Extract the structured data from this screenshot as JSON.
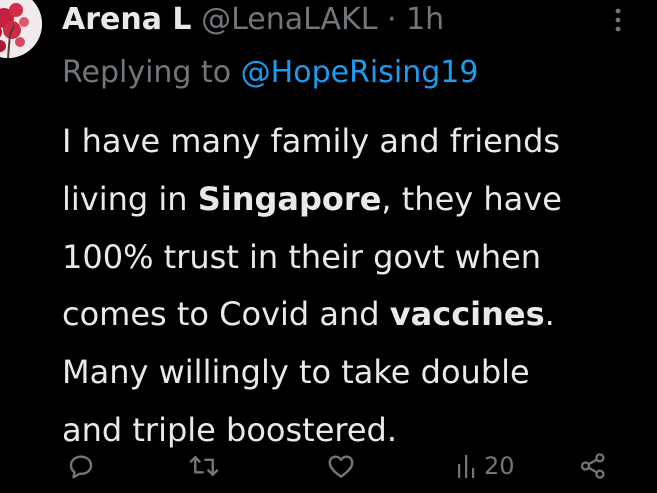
{
  "tweet": {
    "display_name": "Arena L",
    "handle": "@LenaLAKL",
    "separator": "·",
    "time": "1h",
    "replying_prefix": "Replying to ",
    "replying_to": "@HopeRising19",
    "lines": [
      [
        {
          "text": "I have many family and friends",
          "bold": false
        }
      ],
      [
        {
          "text": "living in ",
          "bold": false
        },
        {
          "text": "Singapore",
          "bold": true
        },
        {
          "text": ", they have",
          "bold": false
        }
      ],
      [
        {
          "text": "100% trust in their govt when",
          "bold": false
        }
      ],
      [
        {
          "text": "comes to Covid and ",
          "bold": false
        },
        {
          "text": "vaccines",
          "bold": true
        },
        {
          "text": ".",
          "bold": false
        }
      ],
      [
        {
          "text": "Many willingly to take double",
          "bold": false
        }
      ],
      [
        {
          "text": "and triple boostered.",
          "bold": false
        }
      ]
    ],
    "views_count": "20"
  },
  "colors": {
    "background": "#000000",
    "primary_text": "#e7e9ea",
    "secondary_text": "#71767b",
    "link": "#1d9bf0"
  },
  "icons": [
    "avatar",
    "more-vertical-icon",
    "reply-icon",
    "retweet-icon",
    "like-icon",
    "views-icon",
    "share-icon"
  ]
}
